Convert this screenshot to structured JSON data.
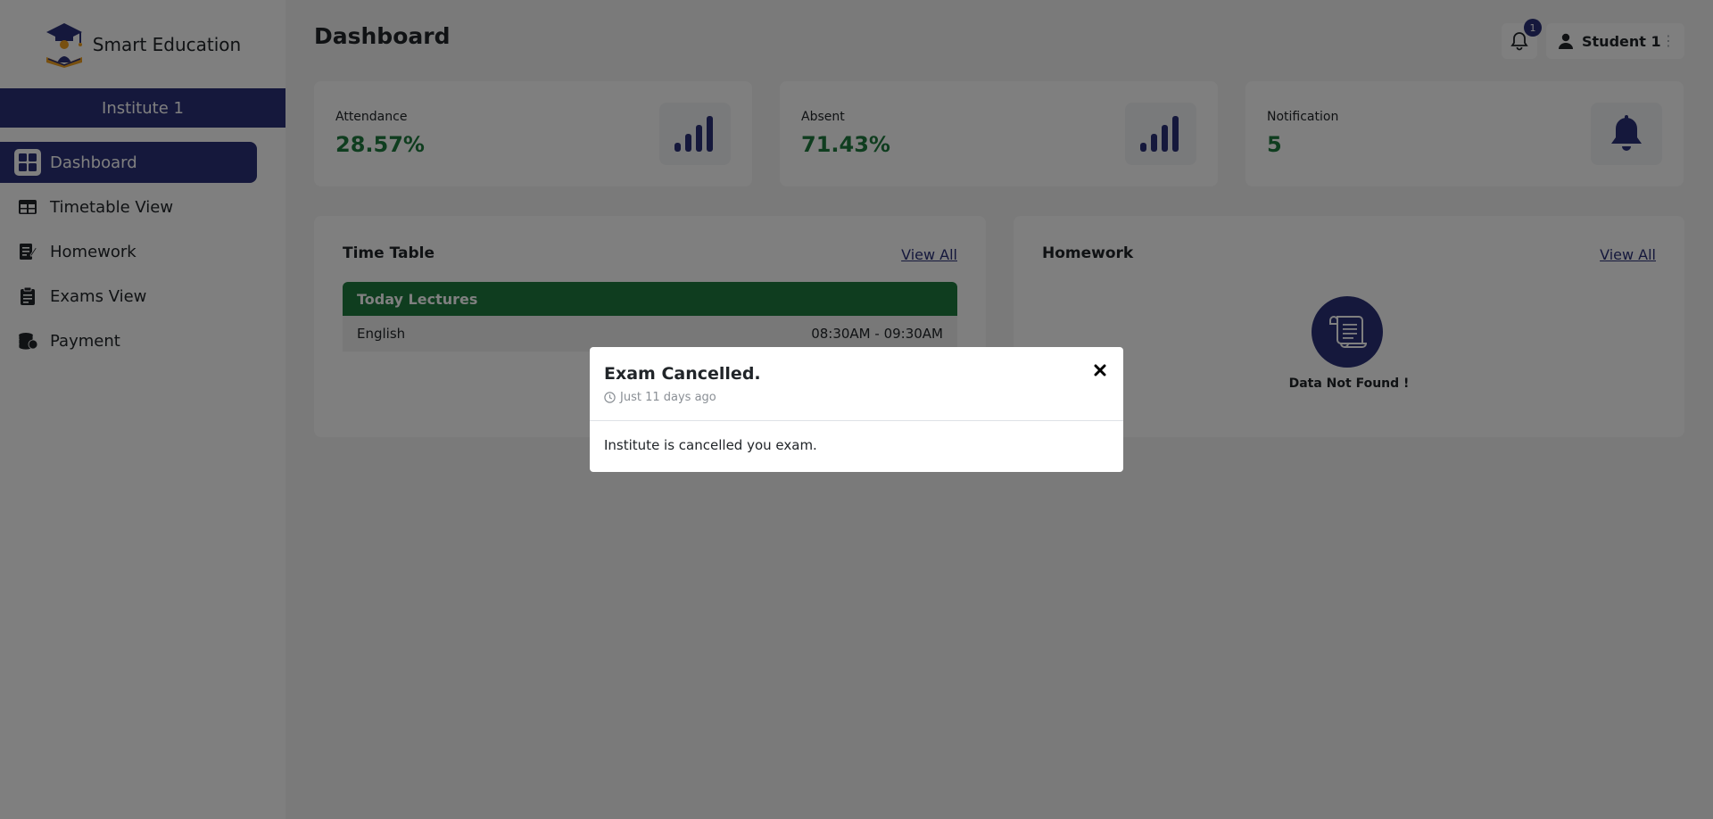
{
  "brand": {
    "name": "Smart Education"
  },
  "institute": {
    "name": "Institute 1"
  },
  "sidebar": {
    "items": [
      {
        "label": "Dashboard",
        "icon": "dashboard-grid-icon",
        "active": true
      },
      {
        "label": "Timetable View",
        "icon": "table-icon",
        "active": false
      },
      {
        "label": "Homework",
        "icon": "notebook-pen-icon",
        "active": false
      },
      {
        "label": "Exams View",
        "icon": "clipboard-icon",
        "active": false
      },
      {
        "label": "Payment",
        "icon": "coins-icon",
        "active": false
      }
    ]
  },
  "header": {
    "title": "Dashboard",
    "notification_count": "1",
    "user_name": "Student 1"
  },
  "stats": [
    {
      "label": "Attendance",
      "value": "28.57%",
      "icon": "signal-bars-icon"
    },
    {
      "label": "Absent",
      "value": "71.43%",
      "icon": "signal-bars-icon"
    },
    {
      "label": "Notification",
      "value": "5",
      "icon": "bell-icon"
    }
  ],
  "timetable": {
    "title": "Time Table",
    "view_all": "View All",
    "section_header": "Today Lectures",
    "lectures": [
      {
        "subject": "English",
        "time": "08:30AM - 09:30AM"
      }
    ]
  },
  "homework": {
    "title": "Homework",
    "view_all": "View All",
    "empty_text": "Data Not Found !",
    "empty_icon": "scroll-icon"
  },
  "modal": {
    "title": "Exam Cancelled.",
    "time": "Just 11 days ago",
    "body": "Institute is cancelled you exam."
  },
  "colors": {
    "primary": "#2a3178",
    "success": "#1f7a3e",
    "overlay": "rgba(0,0,0,0.5)"
  }
}
